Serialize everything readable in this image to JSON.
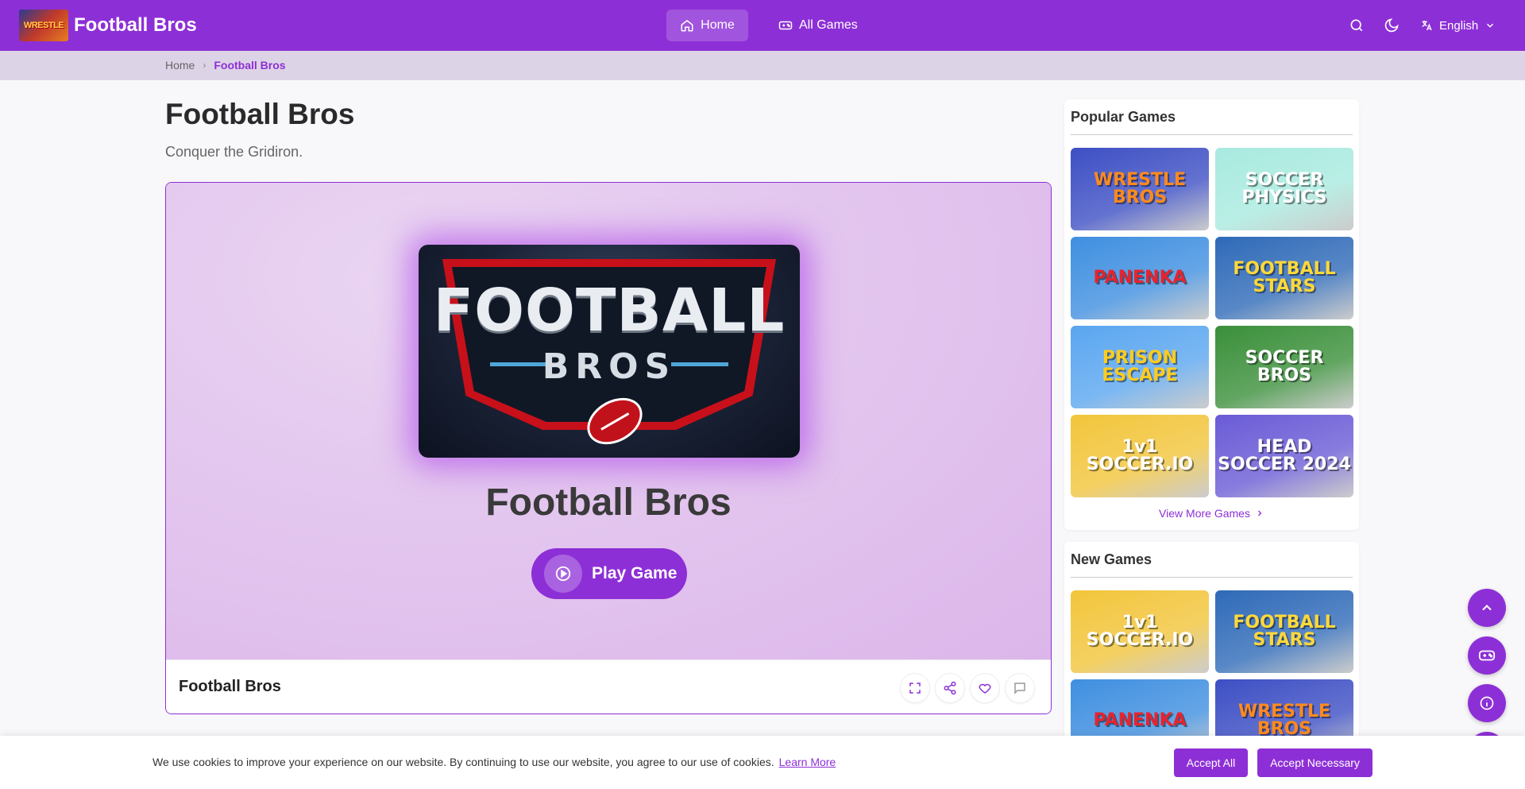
{
  "header": {
    "brand": "Football Bros",
    "logo_text": "WRESTLE",
    "nav": [
      {
        "label": "Home",
        "icon": "home-icon",
        "active": true
      },
      {
        "label": "All Games",
        "icon": "gamepad-icon",
        "active": false
      }
    ],
    "language": "English"
  },
  "breadcrumb": {
    "home": "Home",
    "current": "Football Bros"
  },
  "main": {
    "title": "Football Bros",
    "subtitle": "Conquer the Gridiron.",
    "cover_line1": "FOOTBALL",
    "cover_line2": "BROS",
    "stage_title": "Football Bros",
    "play_label": "Play Game",
    "footer_title": "Football Bros",
    "footer_actions": [
      "fullscreen-icon",
      "share-icon",
      "heart-icon",
      "comment-icon"
    ]
  },
  "sidebar": {
    "popular": {
      "title": "Popular Games",
      "games": [
        {
          "name": "WRESTLE BROS",
          "bg": "#3d4fc4",
          "fg": "#ff8a1e"
        },
        {
          "name": "SOCCER PHYSICS",
          "bg": "#a8eadf",
          "fg": "#ffffff"
        },
        {
          "name": "PANENKA",
          "bg": "#3f8fe0",
          "fg": "#e8232e"
        },
        {
          "name": "FOOTBALL STARS",
          "bg": "#2f6ab8",
          "fg": "#ffd83a"
        },
        {
          "name": "PRISON ESCAPE",
          "bg": "#5aa6f0",
          "fg": "#ffcc1f"
        },
        {
          "name": "SOCCER BROS",
          "bg": "#3a8f3a",
          "fg": "#ffffff"
        },
        {
          "name": "1v1 SOCCER.IO",
          "bg": "#f2c53b",
          "fg": "#ffffff"
        },
        {
          "name": "HEAD SOCCER 2024",
          "bg": "#6a5bd6",
          "fg": "#ffffff"
        }
      ],
      "view_more": "View More Games"
    },
    "new": {
      "title": "New Games",
      "games": [
        {
          "name": "1v1 SOCCER.IO",
          "bg": "#f2c53b",
          "fg": "#ffffff"
        },
        {
          "name": "FOOTBALL STARS",
          "bg": "#2f6ab8",
          "fg": "#ffd83a"
        },
        {
          "name": "PANENKA",
          "bg": "#3f8fe0",
          "fg": "#e8232e"
        },
        {
          "name": "WRESTLE BROS",
          "bg": "#3d4fc4",
          "fg": "#ff8a1e"
        }
      ]
    }
  },
  "cookie": {
    "message": "We use cookies to improve your experience on our website. By continuing to use our website, you agree to our use of cookies.",
    "learn_more": "Learn More",
    "accept_all": "Accept All",
    "accept_necessary": "Accept Necessary"
  },
  "colors": {
    "accent": "#8d2fd6",
    "background": "#f8f7f9"
  }
}
